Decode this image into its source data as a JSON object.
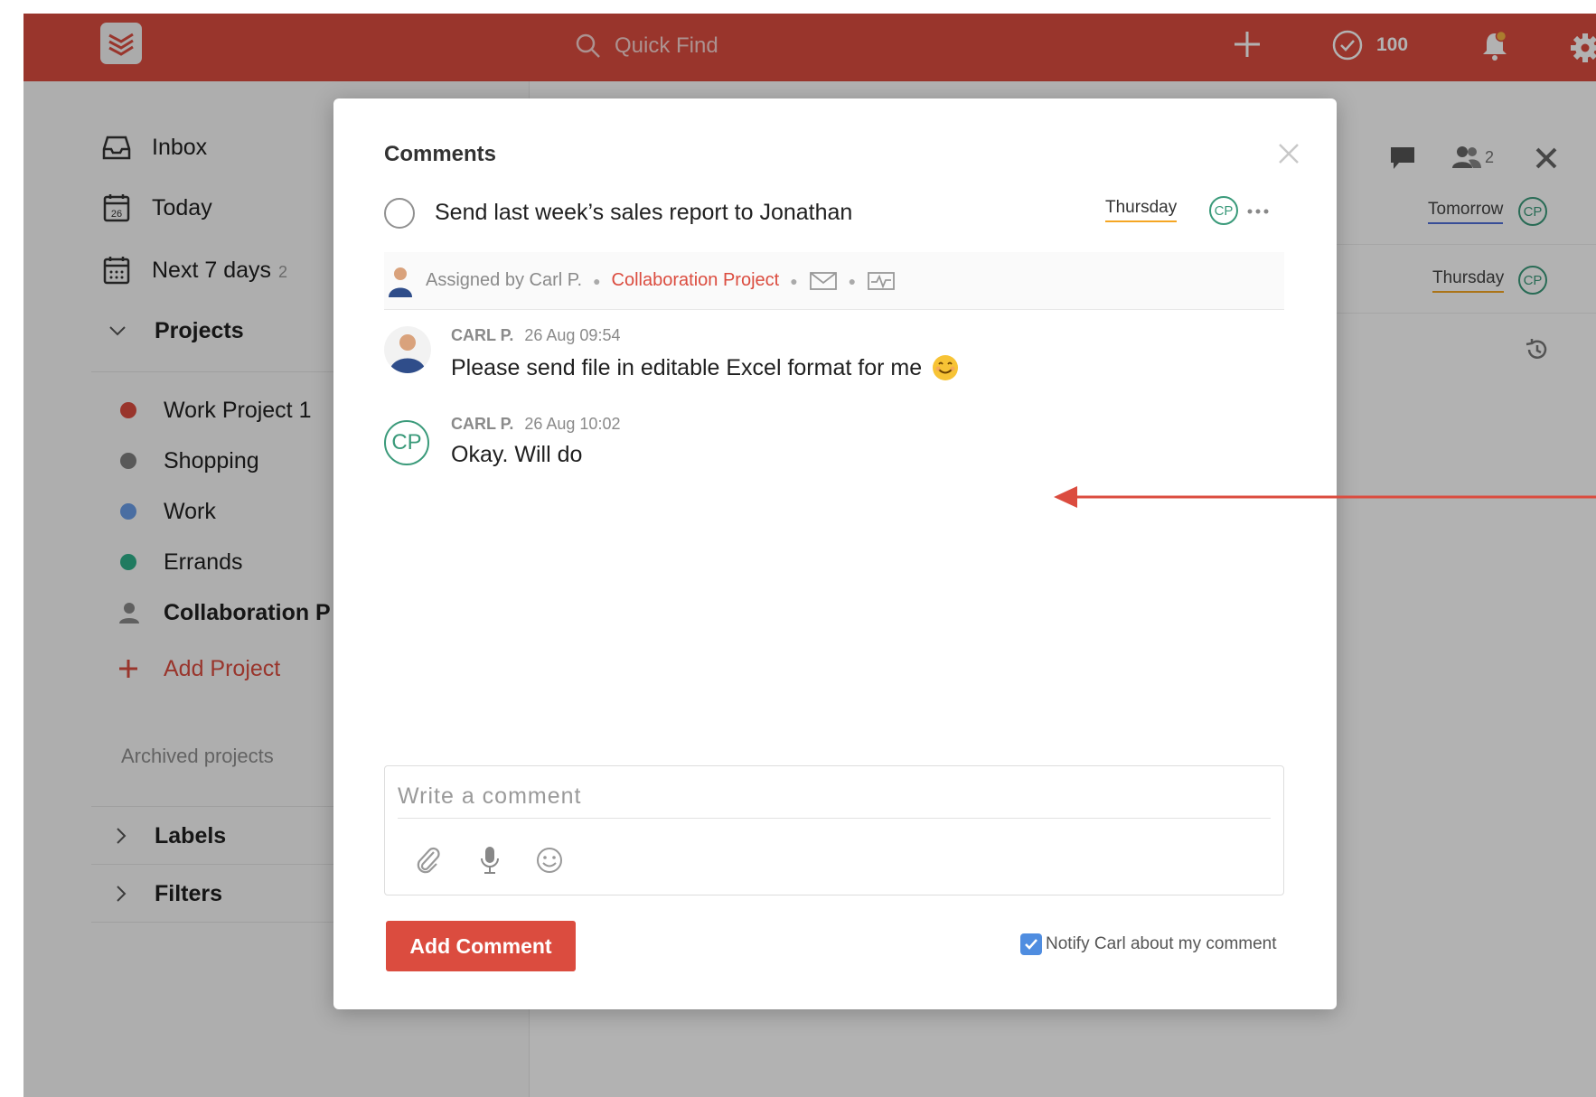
{
  "topbar": {
    "search_placeholder": "Quick Find",
    "karma_count": "100",
    "accent_color": "#db4c3f"
  },
  "sidebar": {
    "inbox": "Inbox",
    "today": "Today",
    "today_day": "26",
    "next7": "Next 7 days",
    "next7_count": "2",
    "projects_header": "Projects",
    "projects": [
      {
        "label": "Work Project 1",
        "color": "#db4c3f"
      },
      {
        "label": "Shopping",
        "color": "#808080"
      },
      {
        "label": "Work",
        "color": "#6b9ee8"
      },
      {
        "label": "Errands",
        "color": "#2eb08a"
      }
    ],
    "collab_project": "Collaboration P",
    "add_project": "Add Project",
    "archived": "Archived projects",
    "labels": "Labels",
    "filters": "Filters"
  },
  "main": {
    "share_count": "2",
    "row1_date": "Tomorrow",
    "row2_date": "Thursday",
    "assignee_initials": "CP"
  },
  "modal": {
    "title": "Comments",
    "task_text": "Send last week’s sales report to Jonathan",
    "task_date": "Thursday",
    "task_assignee": "CP",
    "assigned_by": "Assigned by Carl P.",
    "project": "Collaboration Project",
    "comments": [
      {
        "author": "CARL P.",
        "time": "26 Aug 09:54",
        "text": "Please send file in editable Excel format for me",
        "emoji": "😊"
      },
      {
        "author": "CARL P.",
        "time": "26 Aug 10:02",
        "text": "Okay. Will do",
        "initials": "CP"
      }
    ],
    "comment_placeholder": "Write a comment",
    "add_comment_label": "Add Comment",
    "notify_label": "Notify Carl about my comment"
  }
}
